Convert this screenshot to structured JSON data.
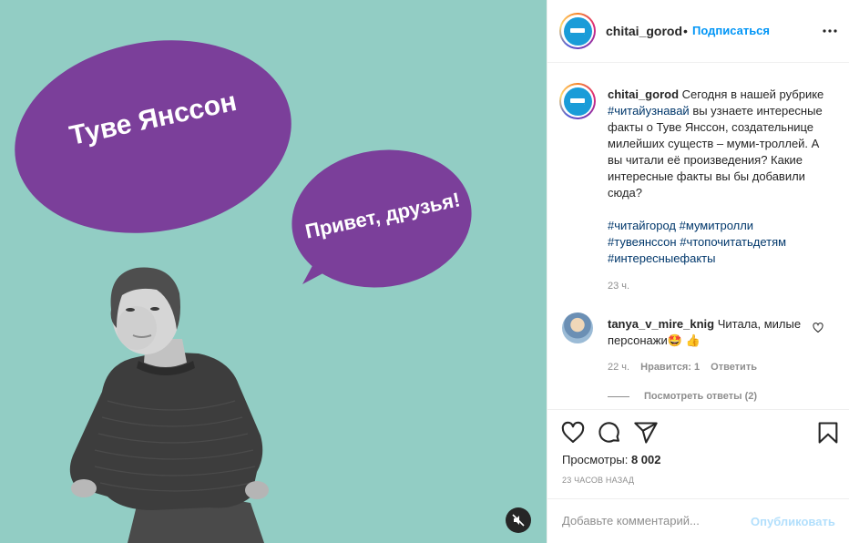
{
  "media": {
    "bubble_large_text": "Туве Янссон",
    "bubble_small_text": "Привет, друзья!",
    "colors": {
      "background": "#92cdc4",
      "bubble": "#7b3f9a"
    },
    "mute_icon": "speaker-muted-icon"
  },
  "header": {
    "username": "chitai_gorod",
    "separator": "•",
    "follow_label": "Подписаться",
    "more_icon": "more-horizontal-icon"
  },
  "caption": {
    "username": "chitai_gorod",
    "text_before_tag": "Сегодня в нашей рубрике",
    "inline_tag": "#читайузнавай",
    "text_after_tag": "вы узнаете интересные факты о Туве Янссон, создательнице милейших существ – муми-троллей. А вы читали её произведения? Какие интересные факты вы бы добавили сюда?",
    "hashtags": [
      "#читайгород",
      "#мумитролли",
      "#тувеянссон",
      "#чтопочитатьдетям",
      "#интересныефакты"
    ],
    "time": "23 ч."
  },
  "comment": {
    "username": "tanya_v_mire_knig",
    "text": "Читала, милые персонажи🤩 👍",
    "time": "22 ч.",
    "likes": "Нравится: 1",
    "reply_label": "Ответить",
    "view_replies": "Посмотреть ответы (2)"
  },
  "actions": {
    "views_label": "Просмотры:",
    "views_count": "8 002",
    "posted_ago": "23 ЧАСОВ НАЗАД"
  },
  "comment_box": {
    "placeholder": "Добавьте комментарий...",
    "publish_label": "Опубликовать"
  },
  "colors": {
    "accent": "#0095f6",
    "hashtag": "#00376b",
    "muted": "#8e8e8e",
    "publish_disabled": "#b2dffc"
  }
}
